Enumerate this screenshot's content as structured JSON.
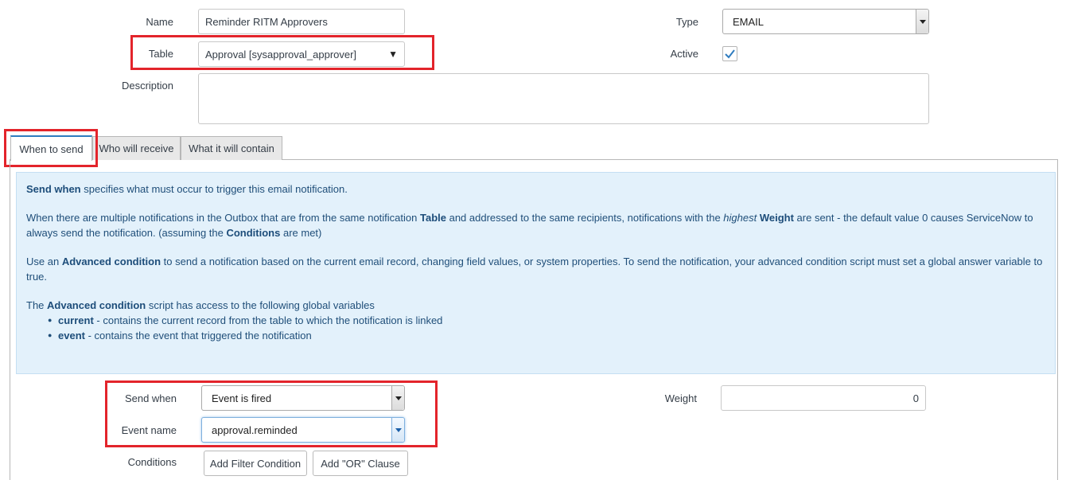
{
  "form": {
    "name_label": "Name",
    "name_value": "Reminder RITM Approvers",
    "table_label": "Table",
    "table_value": "Approval [sysapproval_approver]",
    "description_label": "Description",
    "description_value": "",
    "type_label": "Type",
    "type_value": "EMAIL",
    "active_label": "Active",
    "active_checked": true
  },
  "tabs": [
    {
      "label": "When to send",
      "active": true
    },
    {
      "label": "Who will receive",
      "active": false
    },
    {
      "label": "What it will contain",
      "active": false
    }
  ],
  "info": {
    "p1_bold": "Send when",
    "p1_rest": " specifies what must occur to trigger this email notification.",
    "p2_a": "When there are multiple notifications in the Outbox that are from the same notification ",
    "p2_table": "Table",
    "p2_b": " and addressed to the same recipients, notifications with the ",
    "p2_highest": "highest",
    "p2_weight": "Weight",
    "p2_c": " are sent - the default value 0 causes ServiceNow to always send the notification. (assuming the ",
    "p2_conditions": "Conditions",
    "p2_d": " are met)",
    "p3_a": "Use an ",
    "p3_bold": "Advanced condition",
    "p3_b": " to send a notification based on the current email record, changing field values, or system properties. To send the notification, your advanced condition script must set a global answer variable to true.",
    "p4_a": "The ",
    "p4_bold": "Advanced condition",
    "p4_b": " script has access to the following global variables",
    "bullets": [
      {
        "term": "current",
        "desc": " - contains the current record from the table to which the notification is linked"
      },
      {
        "term": "event",
        "desc": " - contains the event that triggered the notification"
      }
    ]
  },
  "send": {
    "send_when_label": "Send when",
    "send_when_value": "Event is fired",
    "event_name_label": "Event name",
    "event_name_value": "approval.reminded",
    "weight_label": "Weight",
    "weight_value": "0",
    "conditions_label": "Conditions",
    "add_filter_label": "Add Filter Condition",
    "add_or_label": "Add \"OR\" Clause"
  },
  "colors": {
    "highlight_red": "#e3242b",
    "tab_accent": "#2f7cbf",
    "info_bg": "#e3f1fb",
    "check_blue": "#2f7cbf"
  }
}
